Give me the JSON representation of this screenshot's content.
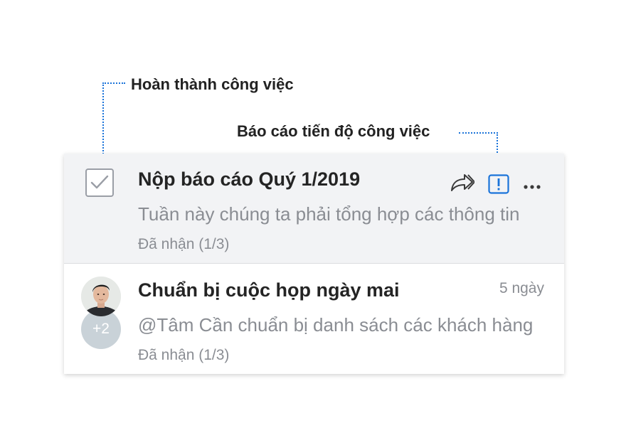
{
  "annotations": {
    "complete_task": "Hoàn thành công việc",
    "report_progress": "Báo cáo tiến độ công việc"
  },
  "tasks": [
    {
      "title": "Nộp báo cáo Quý 1/2019",
      "preview": "Tuần này chúng ta phải tổng hợp các thông tin",
      "status": "Đã nhận (1/3)",
      "icons": [
        "checkbox-checked-icon",
        "forward-icon",
        "exclamation-icon",
        "more-icon"
      ]
    },
    {
      "title": "Chuẩn bị cuộc họp ngày mai",
      "preview": "@Tâm Cần chuẩn bị danh sách các khách hàng",
      "status": "Đã nhận (1/3)",
      "date": "5 ngày",
      "extra_assignees": "+2"
    }
  ],
  "colors": {
    "accent": "#1a73d9",
    "selected_row_bg": "#f2f3f5",
    "muted_text": "#8a8d93"
  }
}
